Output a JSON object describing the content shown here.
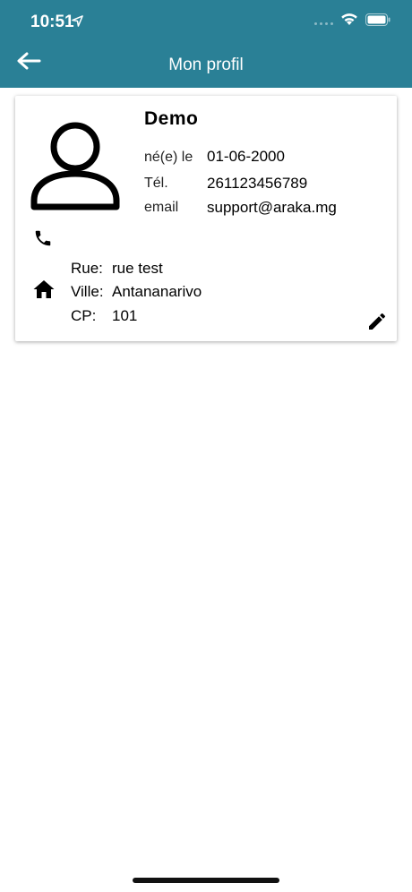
{
  "status_bar": {
    "time": "10:51",
    "icons": [
      "location-arrow-icon",
      "signal-icon",
      "wifi-icon",
      "battery-icon"
    ]
  },
  "header": {
    "title": "Mon profil",
    "back_icon": "arrow-left-icon"
  },
  "colors": {
    "header_bg": "#2a8096",
    "card_bg": "#ffffff"
  },
  "profile": {
    "name": "Demo",
    "fields": [
      {
        "label": "né(e) le",
        "value": "01-06-2000"
      },
      {
        "label": "Tél.",
        "value": "261123456789"
      },
      {
        "label": "email",
        "value": "support@araka.mg"
      }
    ],
    "address": [
      {
        "label": "Rue:",
        "value": "rue test"
      },
      {
        "label": "Ville:",
        "value": "Antananarivo"
      },
      {
        "label": "CP:",
        "value": "101"
      }
    ],
    "icons": [
      "person-avatar-icon",
      "phone-icon",
      "home-icon",
      "pencil-edit-icon"
    ]
  }
}
